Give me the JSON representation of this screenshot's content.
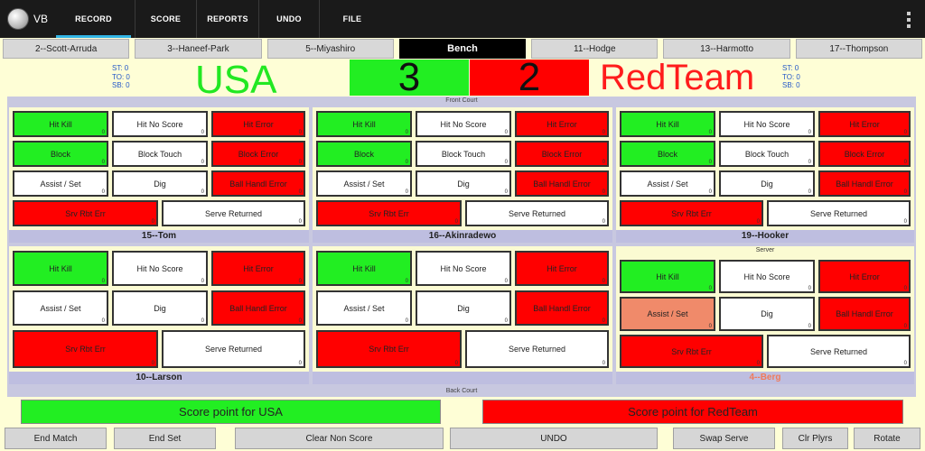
{
  "app": {
    "logo_text": "VB"
  },
  "menu": [
    {
      "label": "RECORD",
      "active": true
    },
    {
      "label": "SCORE",
      "active": false
    },
    {
      "label": "REPORTS",
      "active": false
    },
    {
      "label": "UNDO",
      "active": false
    },
    {
      "label": "FILE",
      "active": false
    }
  ],
  "players": [
    "2--Scott-Arruda",
    "3--Haneef-Park",
    "5--Miyashiro",
    "Bench",
    "11--Hodge",
    "13--Harmotto",
    "17--Thompson"
  ],
  "stats": {
    "left": [
      "ST: 0",
      "TO: 0",
      "SB: 0"
    ],
    "right": [
      "ST: 0",
      "TO: 0",
      "SB: 0"
    ]
  },
  "score": {
    "home_name": "USA",
    "away_name": "RedTeam",
    "home_score": "3",
    "away_score": "2",
    "home_color": "#22e822",
    "away_color": "#ff1c1c"
  },
  "court": {
    "front_label": "Front Court",
    "back_label": "Back Court",
    "server_label": "Server",
    "player_top": [
      "15--Tom",
      "16--Akinradewo",
      "19--Hooker"
    ],
    "player_bottom": [
      "10--Larson",
      "",
      "4--Berg"
    ]
  },
  "buttons": {
    "hit_kill": "Hit Kill",
    "hit_no_score": "Hit No Score",
    "hit_error": "Hit Error",
    "block": "Block",
    "block_touch": "Block Touch",
    "block_error": "Block Error",
    "assist_set": "Assist / Set",
    "dig": "Dig",
    "ball_handl_error": "Ball Handl Error",
    "srv_rbt_err": "Srv Rbt Err",
    "serve_returned": "Serve Returned",
    "count": "0"
  },
  "score_point": {
    "home": "Score point for USA",
    "away": "Score point for RedTeam"
  },
  "bottom": {
    "end_match": "End Match",
    "end_set": "End Set",
    "clear_non_score": "Clear Non Score",
    "undo": "UNDO",
    "swap_serve": "Swap Serve",
    "clr_plyrs": "Clr Plyrs",
    "rotate": "Rotate"
  }
}
